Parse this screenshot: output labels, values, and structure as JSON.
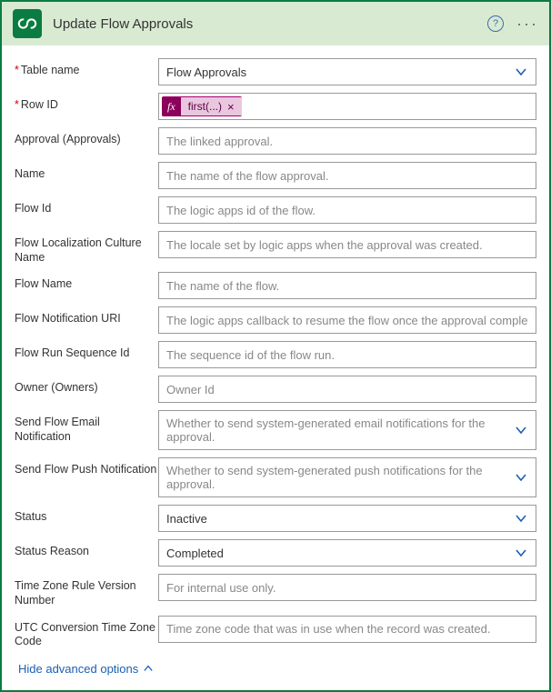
{
  "header": {
    "title": "Update Flow Approvals"
  },
  "fields": {
    "table_name": {
      "label": "Table name",
      "value": "Flow Approvals",
      "required": true
    },
    "row_id": {
      "label": "Row ID",
      "token_prefix": "fx",
      "token_text": "first(...)",
      "required": true
    },
    "approval": {
      "label": "Approval (Approvals)",
      "placeholder": "The linked approval."
    },
    "name": {
      "label": "Name",
      "placeholder": "The name of the flow approval."
    },
    "flow_id": {
      "label": "Flow Id",
      "placeholder": "The logic apps id of the flow."
    },
    "flow_locale": {
      "label": "Flow Localization Culture Name",
      "placeholder": "The locale set by logic apps when the approval was created."
    },
    "flow_name": {
      "label": "Flow Name",
      "placeholder": "The name of the flow."
    },
    "flow_notification_uri": {
      "label": "Flow Notification URI",
      "placeholder": "The logic apps callback to resume the flow once the approval completes."
    },
    "flow_run_seq": {
      "label": "Flow Run Sequence Id",
      "placeholder": "The sequence id of the flow run."
    },
    "owner": {
      "label": "Owner (Owners)",
      "placeholder": "Owner Id"
    },
    "send_email": {
      "label": "Send Flow Email Notification",
      "placeholder": "Whether to send system-generated email notifications for the approval."
    },
    "send_push": {
      "label": "Send Flow Push Notification",
      "placeholder": "Whether to send system-generated push notifications for the approval."
    },
    "status": {
      "label": "Status",
      "value": "Inactive"
    },
    "status_reason": {
      "label": "Status Reason",
      "value": "Completed"
    },
    "tz_rule": {
      "label": "Time Zone Rule Version Number",
      "placeholder": "For internal use only."
    },
    "utc_conv": {
      "label": "UTC Conversion Time Zone Code",
      "placeholder": "Time zone code that was in use when the record was created."
    }
  },
  "footer": {
    "toggle_label": "Hide advanced options"
  }
}
